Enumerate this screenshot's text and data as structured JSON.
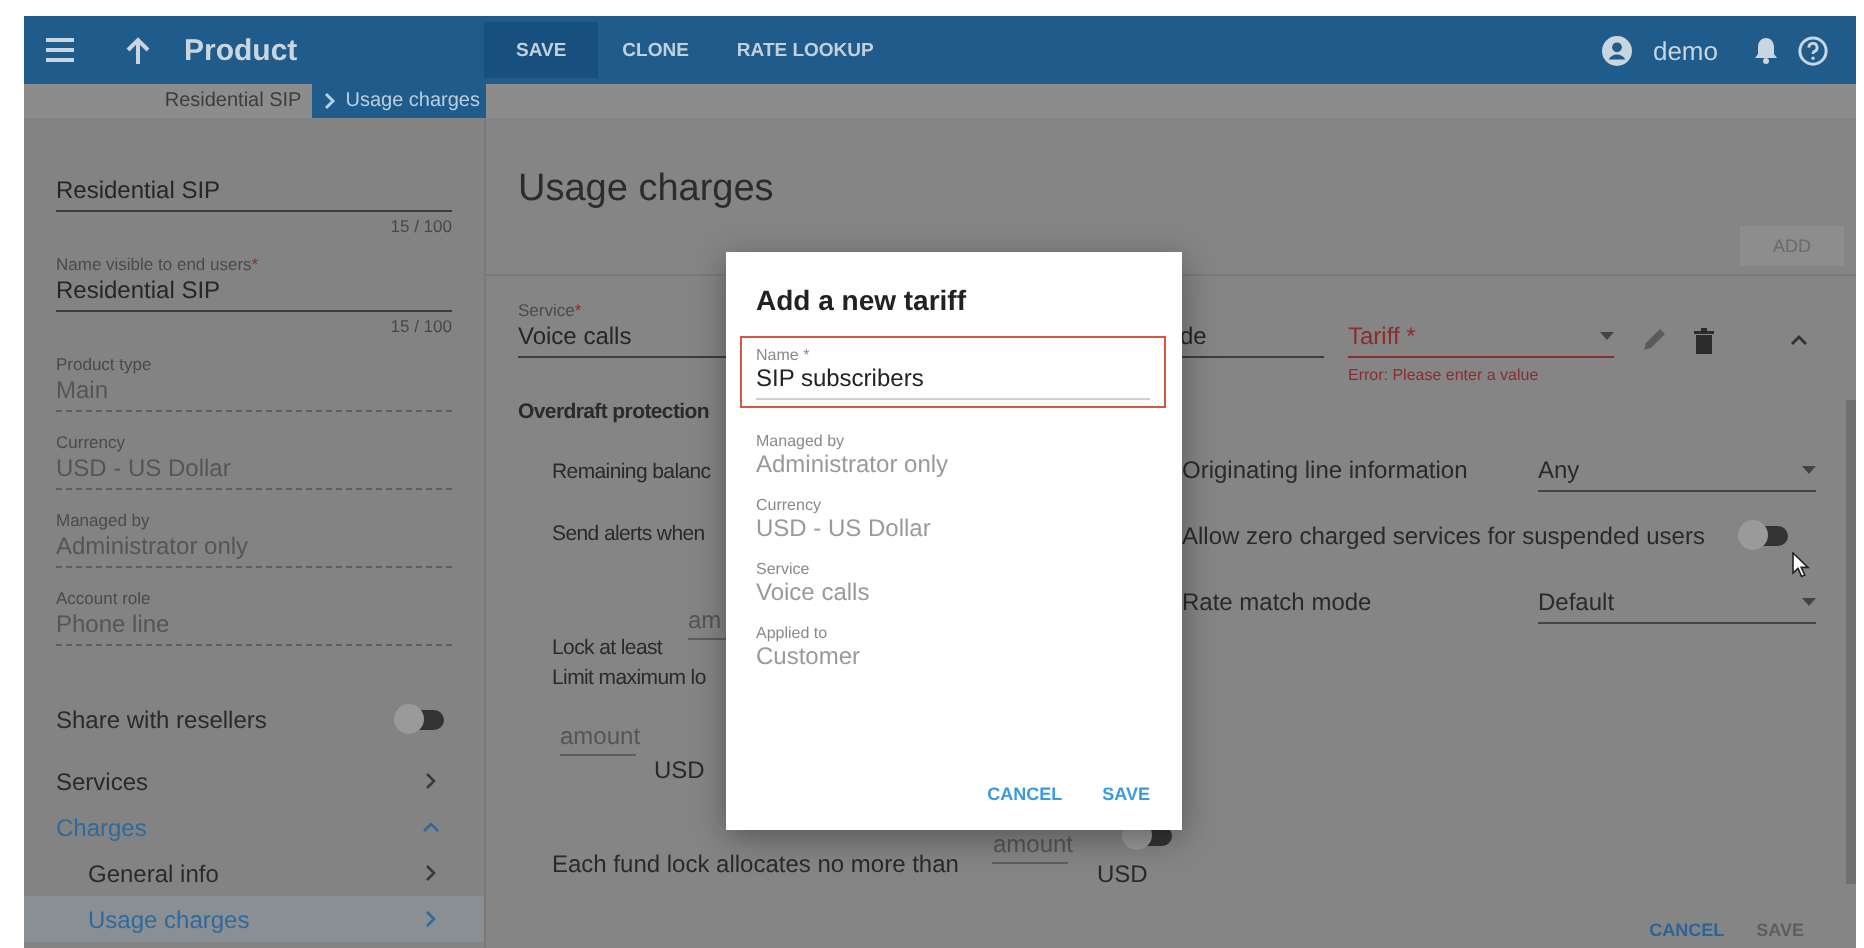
{
  "topbar": {
    "title": "Product",
    "actions": [
      {
        "label": "SAVE",
        "selected": true
      },
      {
        "label": "CLONE",
        "selected": false
      },
      {
        "label": "RATE LOOKUP",
        "selected": false
      }
    ],
    "user": "demo"
  },
  "breadcrumb": [
    {
      "label": "Residential SIP",
      "selected": false
    },
    {
      "label": "Usage charges",
      "selected": true
    }
  ],
  "sidebar": {
    "fields": [
      {
        "kind": "input",
        "value": "Residential SIP",
        "counter": "15 / 100"
      },
      {
        "kind": "input",
        "label": "Name visible to end users",
        "mark": "*",
        "value": "Residential SIP",
        "counter": "15 / 100"
      },
      {
        "kind": "readonly",
        "label": "Product type",
        "value": "Main"
      },
      {
        "kind": "readonly",
        "label": "Currency",
        "value": "USD - US Dollar"
      },
      {
        "kind": "readonly",
        "label": "Managed by",
        "value": "Administrator only"
      },
      {
        "kind": "readonly",
        "label": "Account role",
        "value": "Phone line"
      }
    ],
    "share": {
      "label": "Share with resellers",
      "on": false
    },
    "nav": [
      {
        "label": "Services",
        "expanded": false,
        "active": false
      },
      {
        "label": "Charges",
        "expanded": true,
        "active": true,
        "children": [
          {
            "label": "General info",
            "selected": false
          },
          {
            "label": "Usage charges",
            "selected": true
          }
        ]
      }
    ]
  },
  "main": {
    "title": "Usage charges",
    "add": {
      "label": "ADD",
      "disabled": true
    },
    "service": {
      "label": "Service",
      "mark": "*",
      "value": "Voice calls"
    },
    "code": {
      "value": "de"
    },
    "tariff": {
      "label": "Tariff *",
      "error": "Error: Please enter a value"
    },
    "overdraft": {
      "title": "Overdraft protection",
      "remaining": "Remaining balanc",
      "alerts": "Send alerts when",
      "lock_placeholder": "am",
      "lock": "Lock at least",
      "limit": "Limit maximum lo",
      "limit_placeholder": "amount",
      "limit_currency": "USD",
      "each": "Each fund lock allocates no more than",
      "each_placeholder": "amount",
      "each_currency": "USD",
      "each_on": false
    },
    "options": [
      {
        "kind": "select",
        "label": "Originating line information",
        "value": "Any"
      },
      {
        "kind": "toggle",
        "label": "Allow zero charged services for suspended users",
        "on": false
      },
      {
        "kind": "select",
        "label": "Rate match mode",
        "value": "Default"
      }
    ],
    "footer": [
      {
        "label": "CANCEL",
        "disabled": false
      },
      {
        "label": "SAVE",
        "disabled": true
      }
    ]
  },
  "dialog": {
    "title": "Add a new tariff",
    "name": {
      "label": "Name",
      "mark": "*",
      "value": "SIP subscribers",
      "invalid": true
    },
    "fields": [
      {
        "label": "Managed by",
        "value": "Administrator only"
      },
      {
        "label": "Currency",
        "value": "USD - US Dollar"
      },
      {
        "label": "Service",
        "value": "Voice calls"
      },
      {
        "label": "Applied to",
        "value": "Customer"
      }
    ],
    "buttons": [
      {
        "label": "CANCEL"
      },
      {
        "label": "SAVE"
      }
    ]
  }
}
